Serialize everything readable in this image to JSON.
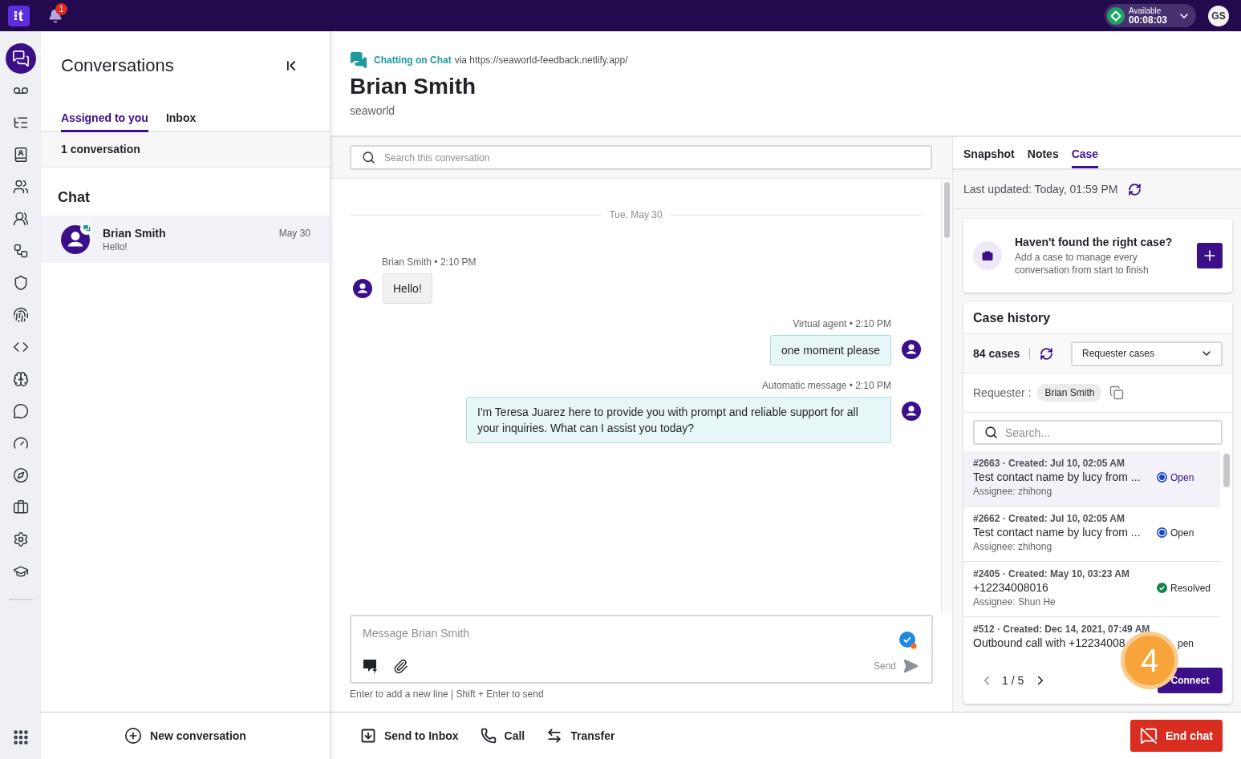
{
  "top_bar": {
    "logo": {
      "text": "t"
    },
    "notifications": {
      "count": "1"
    },
    "status": {
      "label": "Available",
      "timer": "00:08:03"
    },
    "user": {
      "initials": "GS"
    }
  },
  "nav_rail": {
    "items": [
      {
        "selected": true
      },
      {
        "selected": false
      },
      {
        "selected": false
      },
      {
        "selected": false
      },
      {
        "selected": false
      },
      {
        "selected": false
      },
      {
        "selected": false
      },
      {
        "selected": false
      },
      {
        "selected": false
      },
      {
        "selected": false
      },
      {
        "selected": false
      },
      {
        "selected": false
      },
      {
        "selected": false
      },
      {
        "selected": false
      },
      {
        "selected": false
      },
      {
        "selected": false
      },
      {
        "selected": false
      }
    ]
  },
  "conversations": {
    "title": "Conversations",
    "tabs": [
      {
        "label": "Assigned to you",
        "selected": true
      },
      {
        "label": "Inbox",
        "selected": false
      }
    ],
    "count": "1 conversation",
    "section": "Chat",
    "items": [
      {
        "name": "Brian Smith",
        "preview": "Hello!",
        "date": "May 30",
        "selected": true
      }
    ],
    "new_button": "New conversation"
  },
  "conversation": {
    "channel": "Chatting on Chat",
    "via": "via https://seaworld-feedback.netlify.app/",
    "title": "Brian Smith",
    "subtitle": "seaworld",
    "search": {
      "placeholder": "Search this conversation"
    },
    "date_divider": "Tue, May 30",
    "messages": [
      {
        "kind": "customer",
        "meta": "Brian Smith • 2:10 PM",
        "text": "Hello!"
      },
      {
        "kind": "agent",
        "meta": "Virtual agent • 2:10 PM",
        "text": "one moment please"
      },
      {
        "kind": "agent",
        "meta": "Automatic message • 2:10 PM",
        "text": "I'm Teresa Juarez here to provide you with prompt and reliable support for all your inquiries. What can I assist you today?"
      }
    ]
  },
  "composer": {
    "placeholder": "Message Brian Smith",
    "send": "Send",
    "hint": "Enter to add a new line | Shift + Enter to send"
  },
  "actions": [
    {
      "label": "Send to Inbox"
    },
    {
      "label": "Call"
    },
    {
      "label": "Transfer"
    }
  ],
  "end_button": "End chat",
  "details": {
    "tabs": [
      {
        "label": "Snapshot",
        "selected": false
      },
      {
        "label": "Notes",
        "selected": false
      },
      {
        "label": "Case",
        "selected": true
      }
    ],
    "last_updated": "Last updated: Today, 01:59 PM",
    "promo": {
      "title": "Haven't found the right case?",
      "text": "Add a case to manage every conversation from start to finish"
    },
    "case_history": {
      "title": "Case history",
      "count": "84 cases",
      "filter": {
        "value": "Requester cases"
      },
      "requester": {
        "label": "Requester :",
        "value": "Brian Smith"
      },
      "search": {
        "placeholder": "Search..."
      },
      "cases": [
        {
          "header": "#2663 · Created: Jul 10, 02:05 AM",
          "title": "Test contact name by lucy from ...",
          "assignee": "Assignee: zhihong",
          "status": {
            "kind": "open",
            "label": "Open"
          },
          "selected": true
        },
        {
          "header": "#2662 · Created: Jul 10, 02:05 AM",
          "title": "Test contact name by lucy from ...",
          "assignee": "Assignee: zhihong",
          "status": {
            "kind": "open",
            "label": "Open"
          },
          "selected": false
        },
        {
          "header": "#2405 · Created: May 10, 03:23 AM",
          "title": "+12234008016",
          "assignee": "Assignee: Shun He",
          "status": {
            "kind": "resolved",
            "label": "Resolved"
          },
          "selected": false
        },
        {
          "header": "#512 · Created: Dec 14, 2021, 07:49 AM",
          "title": "Outbound call with +12234008",
          "status": {
            "label": "pen"
          },
          "selected": false
        }
      ],
      "pagination": "1 / 5",
      "connect": "Connect"
    }
  },
  "step_badge": "4"
}
